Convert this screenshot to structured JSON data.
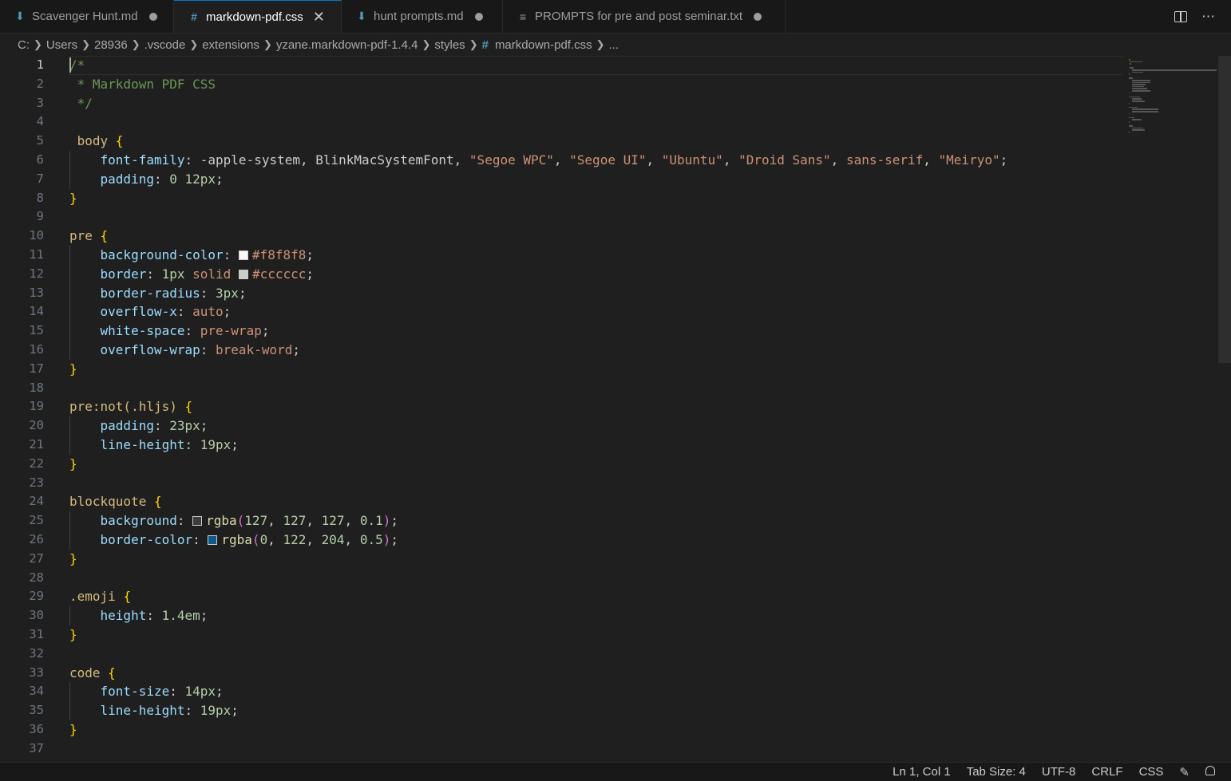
{
  "tabs": [
    {
      "label": "Scavenger Hunt.md",
      "icon": "markdown-icon",
      "active": false,
      "state": "unsaved-dot"
    },
    {
      "label": "markdown-pdf.css",
      "icon": "css-hash-icon",
      "active": true,
      "state": "close"
    },
    {
      "label": "hunt prompts.md",
      "icon": "markdown-icon",
      "active": false,
      "state": "unsaved-dot"
    },
    {
      "label": "PROMPTS  for pre and post seminar.txt",
      "icon": "text-file-icon",
      "active": false,
      "state": "unsaved-dot"
    }
  ],
  "tab_actions": {
    "split_icon": "split-editor-icon",
    "more": "⋯"
  },
  "breadcrumb": [
    "C:",
    "Users",
    "28936",
    ".vscode",
    "extensions",
    "yzane.markdown-pdf-1.4.4",
    "styles",
    "markdown-pdf.css",
    "..."
  ],
  "editor": {
    "language": "css",
    "current_line": 1,
    "lines": [
      "/*",
      " * Markdown PDF CSS",
      " */",
      "",
      " body {",
      "    font-family: -apple-system, BlinkMacSystemFont, \"Segoe WPC\", \"Segoe UI\", \"Ubuntu\", \"Droid Sans\", sans-serif, \"Meiryo\";",
      "    padding: 0 12px;",
      "}",
      "",
      "pre {",
      "    background-color: #f8f8f8;",
      "    border: 1px solid #cccccc;",
      "    border-radius: 3px;",
      "    overflow-x: auto;",
      "    white-space: pre-wrap;",
      "    overflow-wrap: break-word;",
      "}",
      "",
      "pre:not(.hljs) {",
      "    padding: 23px;",
      "    line-height: 19px;",
      "}",
      "",
      "blockquote {",
      "    background: rgba(127, 127, 127, 0.1);",
      "    border-color: rgba(0, 122, 204, 0.5);",
      "}",
      "",
      ".emoji {",
      "    height: 1.4em;",
      "}",
      "",
      "code {",
      "    font-size: 14px;",
      "    line-height: 19px;",
      "}",
      ""
    ]
  },
  "colors": {
    "swatch_f8f8f8": "#f8f8f8",
    "swatch_cccccc": "#cccccc",
    "swatch_rgba_gray": "#3d3d3d",
    "swatch_rgba_blue": "#0f5a8c",
    "accent": "#0078d4"
  },
  "status": {
    "position": "Ln 1, Col 1",
    "tab_size": "Tab Size: 4",
    "encoding": "UTF-8",
    "eol": "CRLF",
    "language": "CSS",
    "feedback_icon": "copilot-icon",
    "notifications_icon": "bell-icon"
  }
}
